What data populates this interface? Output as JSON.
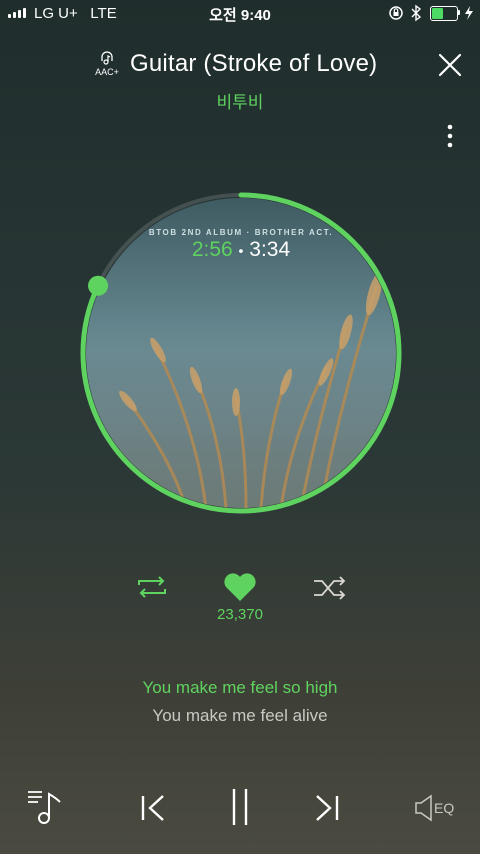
{
  "status_bar": {
    "carrier": "LG U+",
    "network": "LTE",
    "time": "오전 9:40",
    "battery_level": 0.45
  },
  "header": {
    "format_badge": "AAC+",
    "title": "Guitar (Stroke of Love)",
    "artist": "비투비"
  },
  "player": {
    "album_text": "BTOB 2ND ALBUM · BROTHER ACT.",
    "elapsed": "2:56",
    "separator": "•",
    "duration": "3:34",
    "progress_fraction": 0.82,
    "likes": "23,370"
  },
  "lyrics": {
    "current": "You make me feel so high",
    "next": "You make me feel alive"
  },
  "controls": {
    "eq_label": "EQ"
  },
  "colors": {
    "accent": "#5fd35f",
    "secondary_text": "#c9c9c2"
  }
}
